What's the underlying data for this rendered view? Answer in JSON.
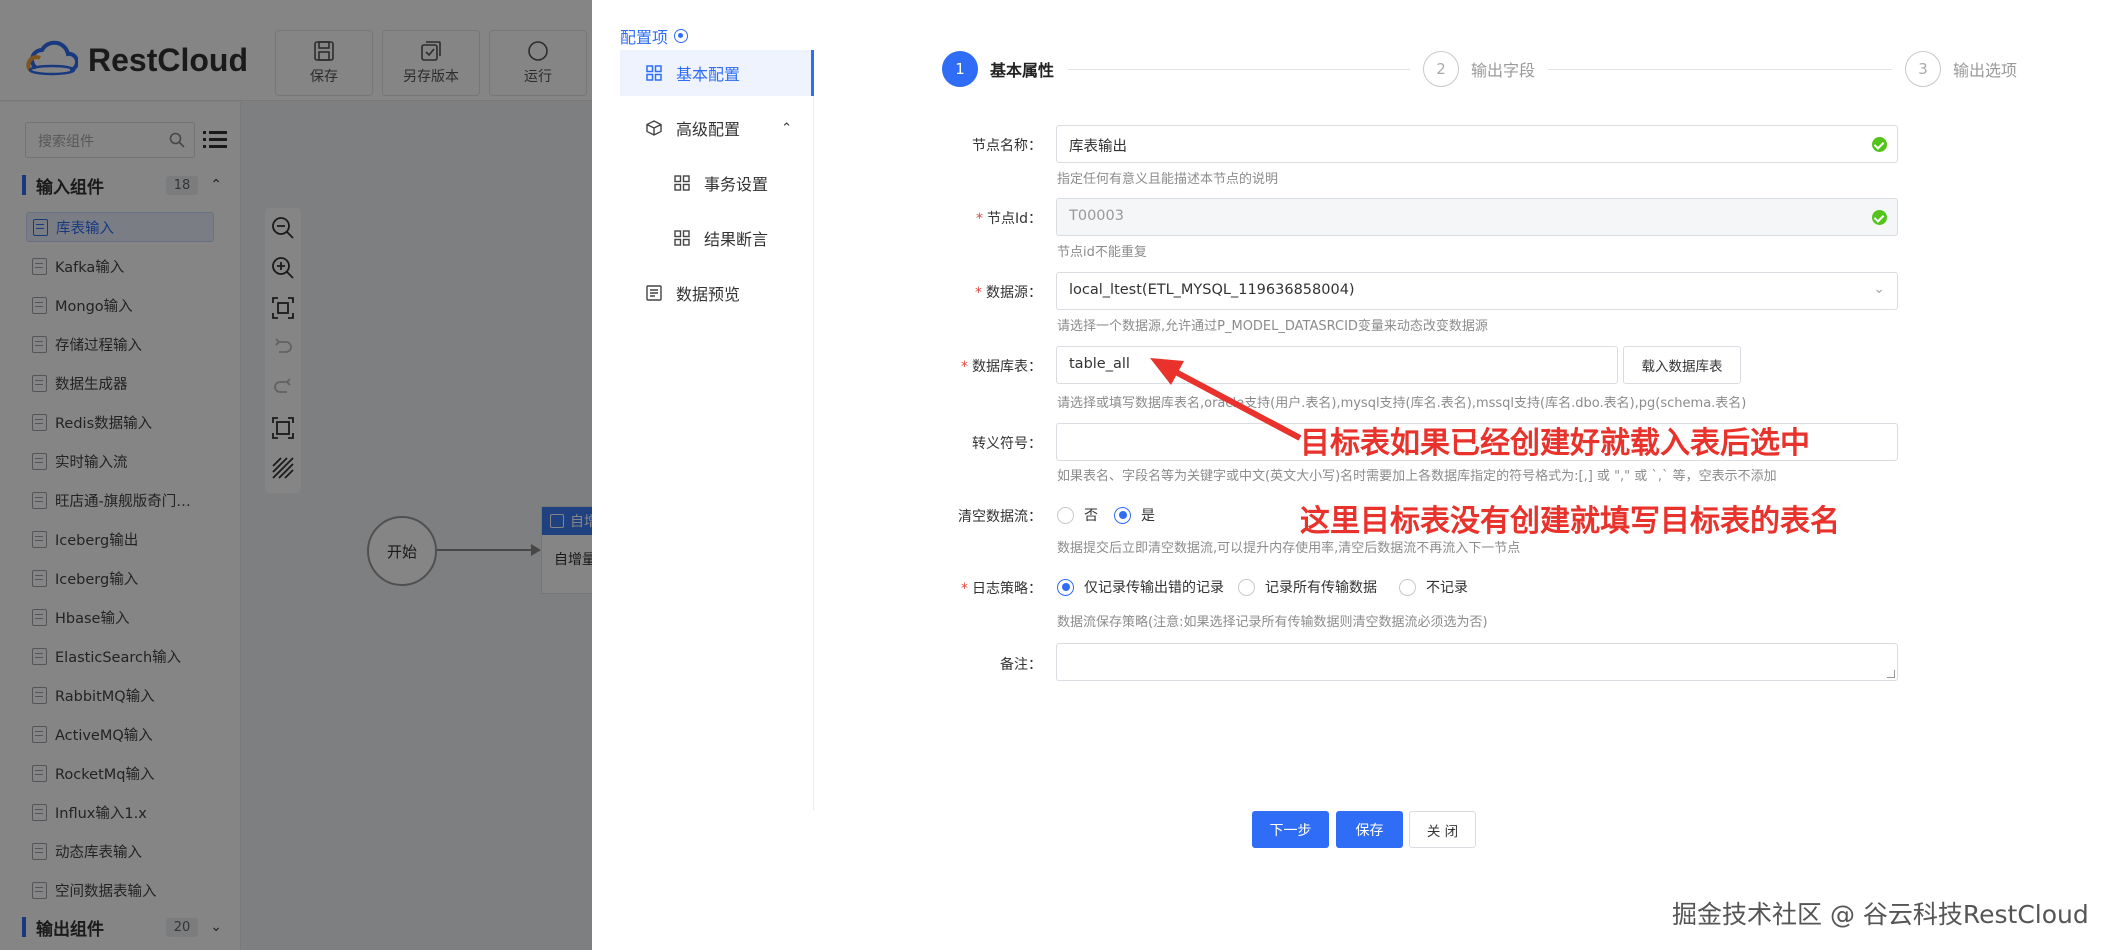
{
  "app": {
    "brand": "RestCloud",
    "toolbar": [
      {
        "label": "保存",
        "icon": "save-icon"
      },
      {
        "label": "另存版本",
        "icon": "save-version-icon"
      },
      {
        "label": "运行",
        "icon": "run-icon"
      }
    ],
    "search_placeholder": "搜索组件",
    "input_group": {
      "title": "输入组件",
      "count": "18"
    },
    "output_group": {
      "title": "输出组件",
      "count": "20"
    },
    "components": [
      "库表输入",
      "Kafka输入",
      "Mongo输入",
      "存储过程输入",
      "数据生成器",
      "Redis数据输入",
      "实时输入流",
      "旺店通-旗舰版奇门…",
      "Iceberg输出",
      "Iceberg输入",
      "Hbase输入",
      "ElasticSearch输入",
      "RabbitMQ输入",
      "ActiveMQ输入",
      "RocketMq输入",
      "Influx输入1.x",
      "动态库表输入",
      "空间数据表输入"
    ],
    "canvas": {
      "start_node": "开始",
      "task_node_title": "自增",
      "task_node_body": "自增量"
    }
  },
  "drawer": {
    "config_title": "配置项",
    "menu": [
      {
        "label": "基本配置",
        "active": true
      },
      {
        "label": "高级配置",
        "expanded": true
      },
      {
        "label": "事务设置"
      },
      {
        "label": "结果断言"
      },
      {
        "label": "数据预览"
      }
    ],
    "steps": [
      {
        "num": "1",
        "label": "基本属性",
        "active": true
      },
      {
        "num": "2",
        "label": "输出字段"
      },
      {
        "num": "3",
        "label": "输出选项"
      }
    ],
    "form": {
      "node_name": {
        "label": "节点名称：",
        "value": "库表输出",
        "hint": "指定任何有意义且能描述本节点的说明"
      },
      "node_id": {
        "label": "节点Id：",
        "value": "T00003",
        "hint": "节点id不能重复"
      },
      "datasource": {
        "label": "数据源：",
        "value": "local_ltest(ETL_MYSQL_119636858004)",
        "hint": "请选择一个数据源,允许通过P_MODEL_DATASRCID变量来动态改变数据源"
      },
      "table": {
        "label": "数据库表：",
        "value": "table_all",
        "load_button": "载入数据库表",
        "hint": "请选择或填写数据库表名,oracle支持(用户.表名),mysql支持(库名.表名),mssql支持(库名.dbo.表名),pg(schema.表名)"
      },
      "escape": {
        "label": "转义符号：",
        "value": "",
        "hint": "如果表名、字段名等为关键字或中文(英文大小写)名时需要加上各数据库指定的符号格式为:[,] 或 \",\" 或 `,` 等，空表示不添加"
      },
      "clear_flow": {
        "label": "清空数据流：",
        "options": [
          "否",
          "是"
        ],
        "selected": "是",
        "hint": "数据提交后立即清空数据流,可以提升内存使用率,清空后数据流不再流入下一节点"
      },
      "log_policy": {
        "label": "日志策略：",
        "options": [
          "仅记录传输出错的记录",
          "记录所有传输数据",
          "不记录"
        ],
        "selected": "仅记录传输出错的记录",
        "hint": "数据流保存策略(注意:如果选择记录所有传输数据则清空数据流必须选为否)"
      },
      "remark": {
        "label": "备注：",
        "value": ""
      }
    },
    "buttons": {
      "next": "下一步",
      "save": "保存",
      "close": "关 闭"
    }
  },
  "annotations": {
    "line1": "目标表如果已经创建好就载入表后选中",
    "line2": "这里目标表没有创建就填写目标表的表名",
    "arrow_color": "#e8322b"
  },
  "watermark": "掘金技术社区 @ 谷云科技RestCloud",
  "colors": {
    "primary": "#2f6df6",
    "annotation": "#e8322b",
    "success": "#52c41a"
  }
}
